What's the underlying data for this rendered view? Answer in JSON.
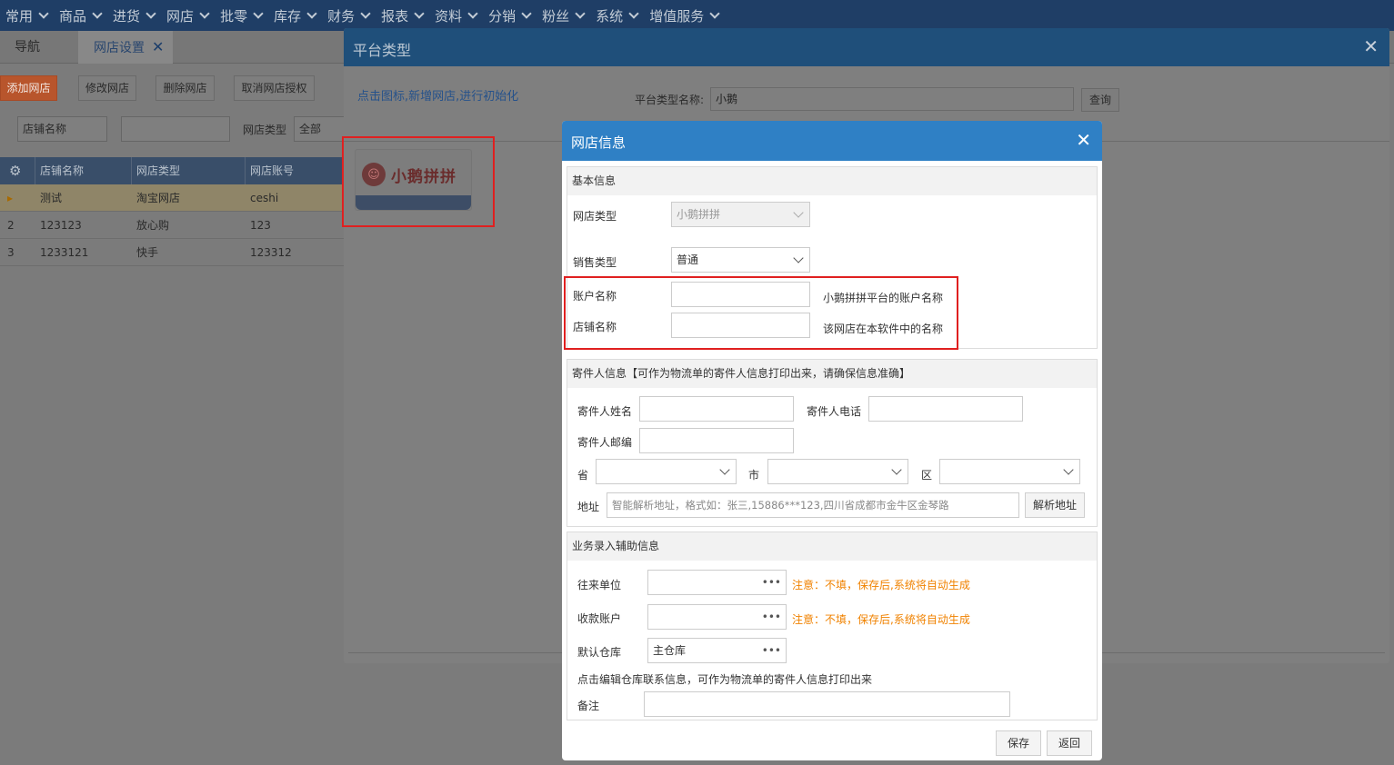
{
  "menu": [
    {
      "label": "常用"
    },
    {
      "label": "商品"
    },
    {
      "label": "进货"
    },
    {
      "label": "网店"
    },
    {
      "label": "批零"
    },
    {
      "label": "库存"
    },
    {
      "label": "财务"
    },
    {
      "label": "报表"
    },
    {
      "label": "资料"
    },
    {
      "label": "分销"
    },
    {
      "label": "粉丝"
    },
    {
      "label": "系统"
    },
    {
      "label": "增值服务"
    }
  ],
  "tabs": {
    "nav": "导航",
    "shop_settings": "网店设置",
    "close_glyph": "✕"
  },
  "toolbar": {
    "add": "添加网店",
    "edit": "修改网店",
    "delete": "删除网店",
    "cancel_auth": "取消网店授权"
  },
  "filters": {
    "field_select": "店铺名称",
    "type_label": "网店类型",
    "type_value": "全部"
  },
  "grid": {
    "headers": [
      "店铺名称",
      "网店类型",
      "网店账号"
    ],
    "rows": [
      {
        "idx": "▸",
        "name": "测试",
        "type": "淘宝网店",
        "account": "ceshi"
      },
      {
        "idx": "2",
        "name": "123123",
        "type": "放心购",
        "account": "123"
      },
      {
        "idx": "3",
        "name": "1233121",
        "type": "快手",
        "account": "123312"
      }
    ]
  },
  "platform_dialog": {
    "title": "平台类型",
    "close": "✕",
    "hint": "点击图标,新增网店,进行初始化",
    "search_label": "平台类型名称:",
    "search_value": "小鹅",
    "query_button": "查询",
    "logo_text": "小鹅拼拼"
  },
  "shop_dialog": {
    "title": "网店信息",
    "close": "✕",
    "basic": {
      "section_title": "基本信息",
      "shop_type_label": "网店类型",
      "shop_type_value": "小鹅拼拼",
      "sale_type_label": "销售类型",
      "sale_type_value": "普通",
      "account_label": "账户名称",
      "account_value": "",
      "account_hint": "小鹅拼拼平台的账户名称",
      "store_label": "店铺名称",
      "store_value": "",
      "store_hint": "该网店在本软件中的名称"
    },
    "sender": {
      "section_title": "寄件人信息【可作为物流单的寄件人信息打印出来，请确保信息准确】",
      "name_label": "寄件人姓名",
      "phone_label": "寄件人电话",
      "zip_label": "寄件人邮编",
      "province_label": "省",
      "city_label": "市",
      "district_label": "区",
      "address_label": "地址",
      "address_placeholder": "智能解析地址，格式如：张三,15886***123,四川省成都市金牛区金琴路",
      "parse_button": "解析地址"
    },
    "aux": {
      "section_title": "业务录入辅助信息",
      "partner_label": "往来单位",
      "partner_note": "注意：不填，保存后,系统将自动生成",
      "account_label": "收款账户",
      "account_note": "注意：不填，保存后,系统将自动生成",
      "warehouse_label": "默认仓库",
      "warehouse_value": "主仓库",
      "warehouse_hint": "点击编辑仓库联系信息，可作为物流单的寄件人信息打印出来",
      "remark_label": "备注",
      "dots": "•••"
    },
    "buttons": {
      "save": "保存",
      "back": "返回"
    }
  }
}
